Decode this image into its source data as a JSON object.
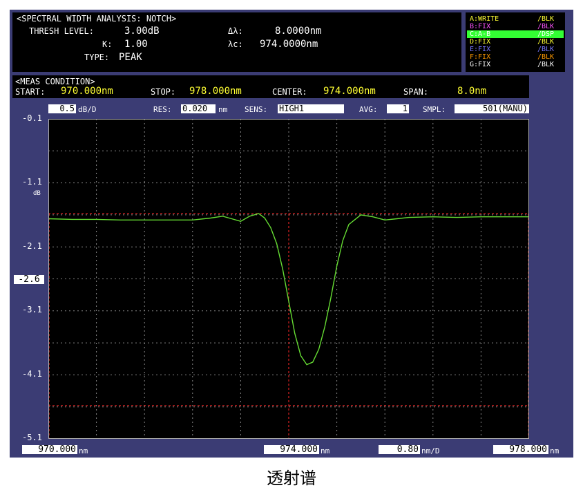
{
  "analysis": {
    "title": "<SPECTRAL WIDTH ANALYSIS: NOTCH>",
    "thresh_label": "THRESH LEVEL:",
    "thresh_value": "3.00dB",
    "k_label": "K:",
    "k_value": "1.00",
    "type_label": "TYPE:",
    "type_value": "PEAK",
    "delta_label": "Δλ:",
    "delta_value": "8.0000nm",
    "center_label": "λc:",
    "center_value": "974.0000nm"
  },
  "traces": [
    {
      "name": "A:WRITE",
      "mode": "/BLK",
      "color": "#ffff33",
      "highlight": false
    },
    {
      "name": "B:FIX",
      "mode": "/BLK",
      "color": "#ff55ff",
      "highlight": false
    },
    {
      "name": "C:A-B",
      "mode": "/DSP",
      "color": "#ffffff",
      "highlight": true
    },
    {
      "name": "D:FIX",
      "mode": "/BLK",
      "color": "#ffff33",
      "highlight": false
    },
    {
      "name": "E:FIX",
      "mode": "/BLK",
      "color": "#7777ff",
      "highlight": false
    },
    {
      "name": "F:FIX",
      "mode": "/BLK",
      "color": "#ff9900",
      "highlight": false
    },
    {
      "name": "G:FIX",
      "mode": "/BLK",
      "color": "#ffffff",
      "highlight": false
    }
  ],
  "trace_highlight_color": "#33ff33",
  "meas": {
    "title": "<MEAS CONDITION>",
    "start_label": "START:",
    "start_value": "970.000nm",
    "stop_label": "STOP:",
    "stop_value": "978.000nm",
    "center_label": "CENTER:",
    "center_value": "974.000nm",
    "span_label": "SPAN:",
    "span_value": "8.0nm"
  },
  "settings": {
    "scale_value": "0.5",
    "scale_unit": "dB/D",
    "res_label": "RES:",
    "res_value": "0.020",
    "res_unit": "nm",
    "sens_label": "SENS:",
    "sens_value": "HIGH1",
    "avg_label": "AVG:",
    "avg_value": "1",
    "smpl_label": "SMPL:",
    "smpl_value": "501(MANU)"
  },
  "bottom": {
    "start_value": "970.000",
    "start_unit": "nm",
    "center_value": "974.000",
    "center_unit": "nm",
    "div_value": "0.80",
    "div_unit": "nm/D",
    "stop_value": "978.000",
    "stop_unit": "nm"
  },
  "y_unit": "dB",
  "marker_label": "-2.6",
  "caption": "透射谱",
  "colors": {
    "screen_bg": "#3b3c74",
    "plot_bg": "#000000",
    "trace": "#66dd33",
    "marker": "#dd2222",
    "grid": "#888888",
    "value_yellow": "#ffff33"
  },
  "chart_data": {
    "type": "line",
    "title": "",
    "xlabel": "",
    "ylabel": "dB",
    "xlim": [
      970.0,
      978.0
    ],
    "ylim": [
      -5.1,
      -0.1
    ],
    "x_ticks": [
      "970.000",
      "974.000",
      "978.000"
    ],
    "y_ticks": [
      "-0.1",
      "-1.1",
      "-2.1",
      "-3.1",
      "-4.1",
      "-5.1"
    ],
    "grid": true,
    "series": [
      {
        "x": [
          970.0,
          970.4,
          970.8,
          971.2,
          971.6,
          972.0,
          972.4,
          972.7,
          972.9,
          973.05,
          973.2,
          973.35,
          973.5,
          973.6,
          973.7,
          973.8,
          973.9,
          974.0,
          974.1,
          974.2,
          974.3,
          974.4,
          974.5,
          974.6,
          974.7,
          974.8,
          974.9,
          975.0,
          975.2,
          975.4,
          975.6,
          975.8,
          976.0,
          976.4,
          976.8,
          977.2,
          977.6,
          978.0
        ],
        "y": [
          -1.66,
          -1.67,
          -1.67,
          -1.68,
          -1.68,
          -1.68,
          -1.68,
          -1.65,
          -1.62,
          -1.66,
          -1.7,
          -1.62,
          -1.58,
          -1.65,
          -1.8,
          -2.05,
          -2.45,
          -2.95,
          -3.45,
          -3.8,
          -3.94,
          -3.9,
          -3.7,
          -3.35,
          -2.9,
          -2.4,
          -2.0,
          -1.75,
          -1.6,
          -1.63,
          -1.68,
          -1.66,
          -1.64,
          -1.63,
          -1.64,
          -1.63,
          -1.63,
          -1.63
        ]
      }
    ],
    "markers": {
      "x": [
        970.0,
        974.0,
        978.0
      ],
      "y": [
        -1.58,
        -4.58
      ]
    }
  }
}
